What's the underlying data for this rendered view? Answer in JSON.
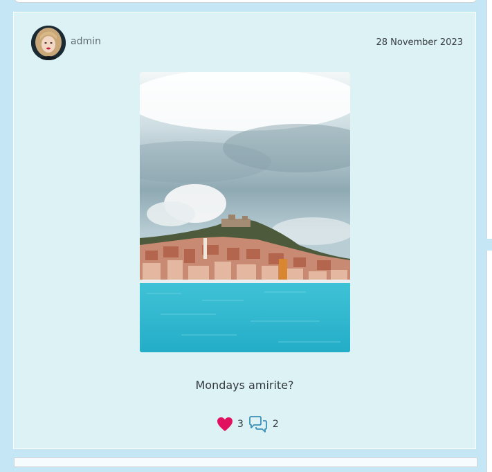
{
  "post": {
    "author": "admin",
    "date": "28 November 2023",
    "caption": "Mondays amirite?",
    "likes": "3",
    "comments": "2",
    "image_subject": "hillside coastal town above turquoise sea"
  },
  "icons": {
    "like": "heart-icon",
    "comment": "comment-bubbles-icon"
  },
  "colors": {
    "page_background": "#c5e7f5",
    "card_background": "#ddf2f5",
    "like_heart": "#e0115f",
    "comment_icon": "#3a8fb7"
  }
}
